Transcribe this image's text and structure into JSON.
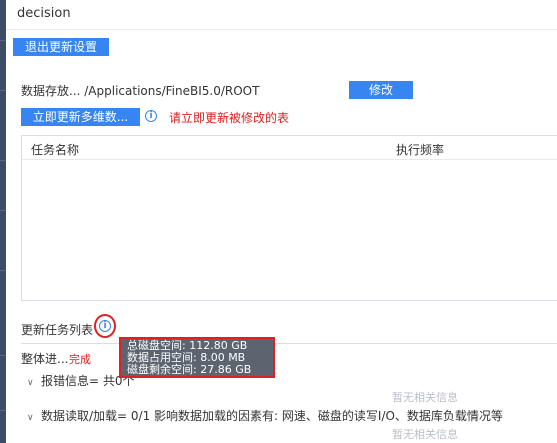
{
  "app": {
    "title": "decision"
  },
  "toolbar": {
    "exit_label": "退出更新设置"
  },
  "storage": {
    "label": "数据存放...  /Applications/FineBI5.0/ROOT",
    "modify_label": "修改"
  },
  "update": {
    "button_label": "立即更新多维数...",
    "info_icon": "info-icon",
    "warning": "请立即更新被修改的表"
  },
  "task_table": {
    "columns": [
      "任务名称",
      "执行频率"
    ],
    "rows": []
  },
  "task_list": {
    "label": "更新任务列表",
    "info_icon": "info-icon"
  },
  "progress": {
    "label": "整体进...",
    "status": "完成"
  },
  "tooltip": {
    "lines": [
      "总磁盘空间: 112.80 GB",
      "数据占用空间: 8.00 MB",
      "磁盘剩余空间: 27.86 GB"
    ]
  },
  "sections": [
    {
      "label": "报错信息= 共0个",
      "empty_text": "暂无相关信息",
      "chevron_icon": "chevron-down-icon"
    },
    {
      "label": "数据读取/加载= 0/1 影响数据加载的因素有: 网速、磁盘的读写I/O、数据库负载情况等",
      "empty_text": "暂无相关信息",
      "chevron_icon": "chevron-down-icon"
    }
  ],
  "colors": {
    "accent": "#3685f2",
    "warning": "#e02020",
    "tooltip_bg": "#5c6470",
    "sidebar": "#3b4d66"
  }
}
